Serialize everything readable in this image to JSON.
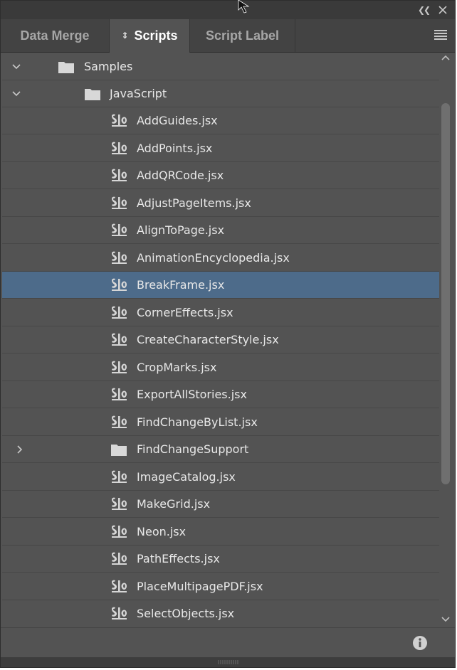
{
  "tabs": [
    {
      "label": "Data Merge",
      "active": false
    },
    {
      "label": "Scripts",
      "active": true
    },
    {
      "label": "Script Label",
      "active": false
    }
  ],
  "colors": {
    "panel_bg": "#535353",
    "tabbar_bg": "#434343",
    "selected_row": "#4d6b8a",
    "text": "#e8e8e8"
  },
  "tree": {
    "samples_folder": "Samples",
    "javascript_folder": "JavaScript",
    "items": [
      {
        "label": "AddGuides.jsx",
        "type": "script"
      },
      {
        "label": "AddPoints.jsx",
        "type": "script"
      },
      {
        "label": "AddQRCode.jsx",
        "type": "script"
      },
      {
        "label": "AdjustPageItems.jsx",
        "type": "script"
      },
      {
        "label": "AlignToPage.jsx",
        "type": "script"
      },
      {
        "label": "AnimationEncyclopedia.jsx",
        "type": "script"
      },
      {
        "label": "BreakFrame.jsx",
        "type": "script",
        "selected": true
      },
      {
        "label": "CornerEffects.jsx",
        "type": "script"
      },
      {
        "label": "CreateCharacterStyle.jsx",
        "type": "script"
      },
      {
        "label": "CropMarks.jsx",
        "type": "script"
      },
      {
        "label": "ExportAllStories.jsx",
        "type": "script"
      },
      {
        "label": "FindChangeByList.jsx",
        "type": "script"
      },
      {
        "label": "FindChangeSupport",
        "type": "folder",
        "collapsed": true
      },
      {
        "label": "ImageCatalog.jsx",
        "type": "script"
      },
      {
        "label": "MakeGrid.jsx",
        "type": "script"
      },
      {
        "label": "Neon.jsx",
        "type": "script"
      },
      {
        "label": "PathEffects.jsx",
        "type": "script"
      },
      {
        "label": "PlaceMultipagePDF.jsx",
        "type": "script"
      },
      {
        "label": "SelectObjects.jsx",
        "type": "script"
      }
    ]
  },
  "icons": {
    "script": "script-icon",
    "folder": "folder-icon",
    "info": "info-icon",
    "menu": "panel-menu-icon",
    "collapse": "collapse-panel-icon",
    "close": "close-icon"
  }
}
